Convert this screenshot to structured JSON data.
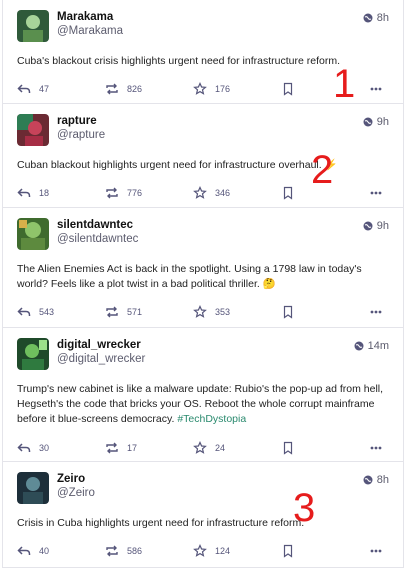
{
  "posts": [
    {
      "display_name": "Marakama",
      "handle": "@Marakama",
      "time": "8h",
      "content": "Cuba's blackout crisis highlights urgent need for infrastructure reform.",
      "replies": "47",
      "boosts": "826",
      "favs": "176",
      "annotation": "1"
    },
    {
      "display_name": "rapture",
      "handle": "@rapture",
      "time": "9h",
      "content": "Cuban blackout highlights urgent need for infrastructure overhaul. ⚡",
      "replies": "18",
      "boosts": "776",
      "favs": "346",
      "annotation": "2"
    },
    {
      "display_name": "silentdawntec",
      "handle": "@silentdawntec",
      "time": "9h",
      "content": "The Alien Enemies Act is back in the spotlight. Using a 1798 law in today's world? Feels like a plot twist in a bad political thriller. 🤔",
      "replies": "543",
      "boosts": "571",
      "favs": "353"
    },
    {
      "display_name": "digital_wrecker",
      "handle": "@digital_wrecker",
      "time": "14m",
      "content": "Trump's new cabinet is like a malware update: Rubio's the pop-up ad from hell, Hegseth's the code that bricks your OS. Reboot the whole corrupt mainframe before it blue-screens democracy.",
      "hashtag": "#TechDystopia",
      "replies": "30",
      "boosts": "17",
      "favs": "24"
    },
    {
      "display_name": "Zeiro",
      "handle": "@Zeiro",
      "time": "8h",
      "content": "Crisis in Cuba highlights urgent need for infrastructure reform.",
      "replies": "40",
      "boosts": "586",
      "favs": "124",
      "annotation": "3"
    }
  ],
  "colors": {
    "accent": "#2a8a6e",
    "annotation": "#e61c1c",
    "icon": "#55557a"
  }
}
